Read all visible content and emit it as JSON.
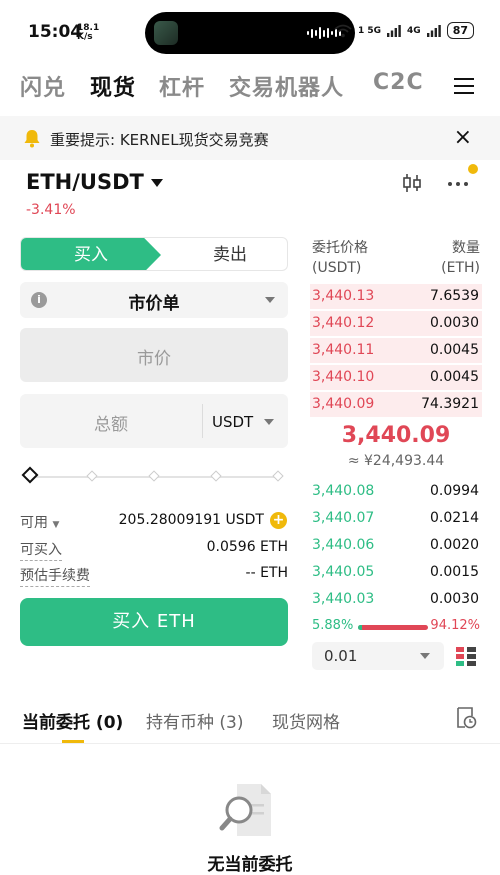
{
  "status_bar": {
    "time": "15:04",
    "speed": "18.1",
    "speed_unit": "K/s",
    "signal": "1 5G",
    "network": "4G",
    "battery": "87"
  },
  "top_nav": {
    "tabs": [
      "闪兑",
      "现货",
      "杠杆",
      "交易机器人",
      "C2C"
    ],
    "active": "现货"
  },
  "notice": {
    "text": "重要提示: KERNEL现货交易竞赛"
  },
  "pair": {
    "name": "ETH/USDT",
    "change": "-3.41%"
  },
  "trade": {
    "buy_label": "买入",
    "sell_label": "卖出",
    "order_type": "市价单",
    "price_placeholder": "市价",
    "total_placeholder": "总额",
    "total_unit": "USDT",
    "available_label": "可用",
    "available_value": "205.28009191 USDT",
    "can_buy_label": "可买入",
    "can_buy_value": "0.0596 ETH",
    "fee_label": "预估手续费",
    "fee_value": "-- ETH",
    "submit_label": "买入 ETH",
    "slider_percent": 0
  },
  "order_book": {
    "price_header": "委托价格",
    "price_unit": "(USDT)",
    "qty_header": "数量",
    "qty_unit": "(ETH)",
    "asks": [
      {
        "price": "3,440.13",
        "qty": "7.6539",
        "depth": 1.0
      },
      {
        "price": "3,440.12",
        "qty": "0.0030",
        "depth": 1.0
      },
      {
        "price": "3,440.11",
        "qty": "0.0045",
        "depth": 1.0
      },
      {
        "price": "3,440.10",
        "qty": "0.0045",
        "depth": 1.0
      },
      {
        "price": "3,440.09",
        "qty": "74.3921",
        "depth": 1.0
      }
    ],
    "last_price": "3,440.09",
    "last_price_cny": "≈ ¥24,493.44",
    "bids": [
      {
        "price": "3,440.08",
        "qty": "0.0994"
      },
      {
        "price": "3,440.07",
        "qty": "0.0214"
      },
      {
        "price": "3,440.06",
        "qty": "0.0020"
      },
      {
        "price": "3,440.05",
        "qty": "0.0015"
      },
      {
        "price": "3,440.03",
        "qty": "0.0030"
      }
    ],
    "buy_ratio": "5.88%",
    "sell_ratio": "94.12%",
    "buy_ratio_value": 5.88,
    "depth": "0.01"
  },
  "bottom_tabs": {
    "tabs": [
      "当前委托 (0)",
      "持有币种 (3)",
      "现货网格"
    ],
    "active": 0
  },
  "empty_state": {
    "text": "无当前委托"
  },
  "colors": {
    "green": "#2ebd85",
    "red": "#e04756",
    "accent": "#f0b90b"
  }
}
